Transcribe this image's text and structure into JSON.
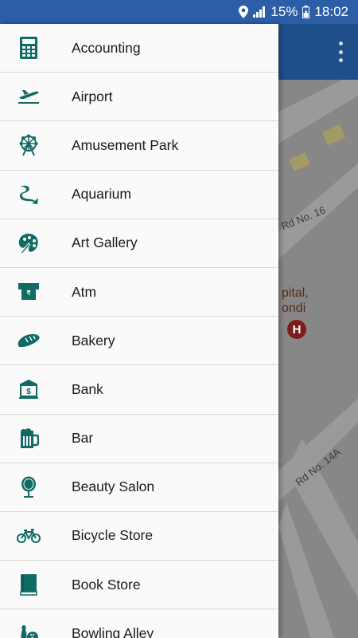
{
  "status_bar": {
    "battery_percent": "15%",
    "time": "18:02",
    "icons": [
      "location-icon",
      "signal-icon",
      "battery-icon"
    ]
  },
  "map": {
    "road_label_1": "Rd No. 16",
    "road_label_2": "Rd No. 14A",
    "place_label_line1": "pital,",
    "place_label_line2": "ondi",
    "hospital_marker": "H"
  },
  "drawer": {
    "items": [
      {
        "label": "Accounting",
        "icon": "calculator-icon"
      },
      {
        "label": "Airport",
        "icon": "airplane-icon"
      },
      {
        "label": "Amusement Park",
        "icon": "ferris-wheel-icon"
      },
      {
        "label": "Aquarium",
        "icon": "fish-icon"
      },
      {
        "label": "Art Gallery",
        "icon": "palette-icon"
      },
      {
        "label": "Atm",
        "icon": "atm-icon"
      },
      {
        "label": "Bakery",
        "icon": "bread-icon"
      },
      {
        "label": "Bank",
        "icon": "bank-icon"
      },
      {
        "label": "Bar",
        "icon": "beer-mug-icon"
      },
      {
        "label": "Beauty Salon",
        "icon": "mirror-icon"
      },
      {
        "label": "Bicycle Store",
        "icon": "bicycle-icon"
      },
      {
        "label": "Book Store",
        "icon": "book-icon"
      },
      {
        "label": "Bowling Alley",
        "icon": "bowling-icon"
      }
    ]
  },
  "colors": {
    "status_bar": "#2c5ea8",
    "app_bar": "#1f4f8a",
    "icon_teal": "#0f6b64",
    "drawer_bg": "#fafafa",
    "map_bg": "#8a8a8a"
  }
}
